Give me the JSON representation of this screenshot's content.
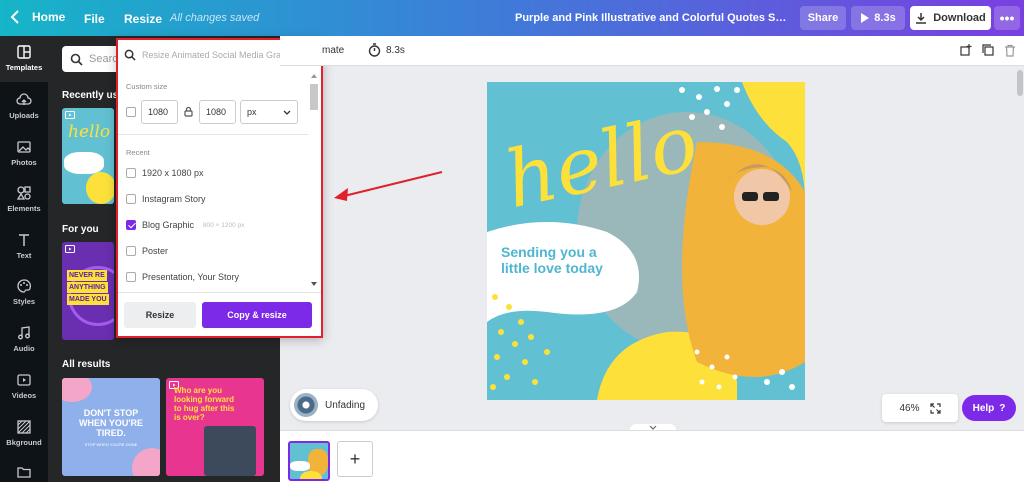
{
  "topbar": {
    "home_label": "Home",
    "file_label": "File",
    "resize_label": "Resize",
    "saved_status": "All changes saved",
    "doc_title": "Purple and Pink Illustrative and Colorful Quotes Social Medi...",
    "share_label": "Share",
    "play_label": "8.3s",
    "download_label": "Download",
    "more_label": "•••"
  },
  "rail": {
    "items": [
      {
        "label": "Templates",
        "icon": "templates-icon"
      },
      {
        "label": "Uploads",
        "icon": "upload-cloud-icon"
      },
      {
        "label": "Photos",
        "icon": "image-icon"
      },
      {
        "label": "Elements",
        "icon": "shapes-icon"
      },
      {
        "label": "Text",
        "icon": "text-t-icon"
      },
      {
        "label": "Styles",
        "icon": "palette-icon"
      },
      {
        "label": "Audio",
        "icon": "music-note-icon"
      },
      {
        "label": "Videos",
        "icon": "video-icon"
      },
      {
        "label": "Bkground",
        "icon": "background-pattern-icon"
      }
    ]
  },
  "panel": {
    "search_placeholder": "Searc",
    "recently_used": "Recently us",
    "for_you": "For you",
    "all_results": "All results",
    "thumb1_text": "hello",
    "thumb2_lines": [
      "NEVER RE",
      "ANYTHING",
      "MADE YOU"
    ],
    "thumb3_lines": [
      "DON'T STOP",
      "WHEN YOU'RE",
      "TIRED."
    ],
    "thumb3_sub": "STOP WHEN YOU'RE DONE",
    "thumb4_lines": [
      "Who are you",
      "looking forward",
      "to hug after this",
      "is over?"
    ]
  },
  "resize_popup": {
    "search_placeholder": "Resize Animated Social Media Graph",
    "custom_size_label": "Custom size",
    "width_value": "1080",
    "height_value": "1080",
    "unit_value": "px",
    "recent_label": "Recent",
    "options": [
      {
        "label": "1920 x 1080 px",
        "sub": "",
        "checked": false
      },
      {
        "label": "Instagram Story",
        "sub": "",
        "checked": false
      },
      {
        "label": "Blog Graphic",
        "sub": "800 × 1200 px",
        "checked": true
      },
      {
        "label": "Poster",
        "sub": "",
        "checked": false
      },
      {
        "label": "Presentation, Your Story",
        "sub": "",
        "checked": false
      }
    ],
    "resize_button": "Resize",
    "copy_resize_button": "Copy & resize"
  },
  "edit_toolbar": {
    "animate_label": "mate",
    "timer_label": "8.3s"
  },
  "canvas": {
    "hello_text": "hello",
    "quote_line1": "Sending you a",
    "quote_line2": "little love today"
  },
  "animation_pill": {
    "label": "Unfading"
  },
  "zoom": {
    "value": "46%"
  },
  "help": {
    "label": "Help",
    "symbol": "?"
  },
  "pages": {
    "add_symbol": "+"
  },
  "colors": {
    "accent": "#7d2ae8",
    "canvas_bg": "#62c0d3",
    "yellow": "#fde13a",
    "highlight_border": "#e0202a"
  }
}
